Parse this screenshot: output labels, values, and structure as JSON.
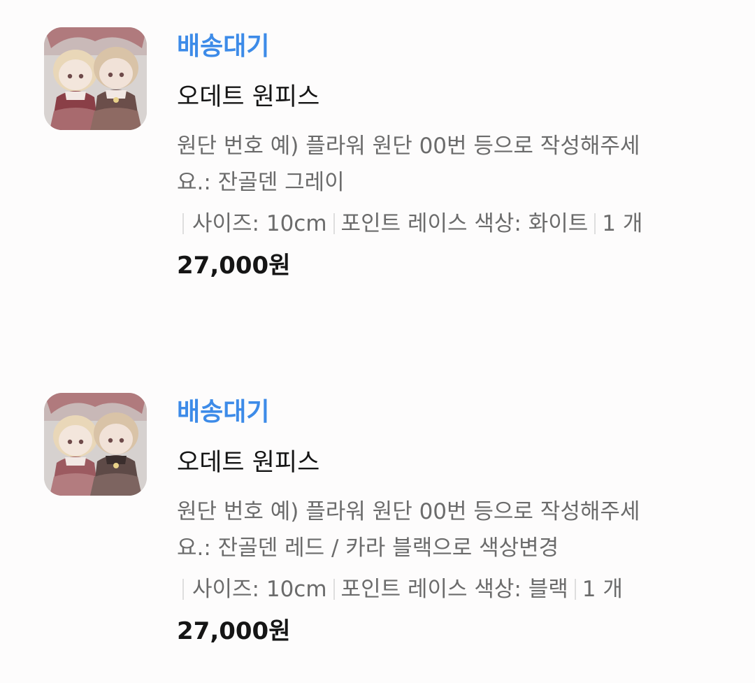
{
  "orders": [
    {
      "status": "배송대기",
      "product_name": "오데트 원피스",
      "option_line1": "원단 번호 예) 플라워 원단 00번 등으로 작성해주세",
      "option_line2": "요.: 잔골덴 그레이",
      "size": "사이즈: 10cm",
      "lace_color": "포인트 레이스 색상: 화이트",
      "quantity": "1 개",
      "price": "27,000원",
      "thumbnail_icon": "doll-photo"
    },
    {
      "status": "배송대기",
      "product_name": "오데트 원피스",
      "option_line1": "원단 번호 예) 플라워 원단 00번 등으로 작성해주세",
      "option_line2": "요.: 잔골덴 레드 / 카라 블랙으로 색상변경",
      "size": "사이즈: 10cm",
      "lace_color": "포인트 레이스 색상: 블랙",
      "quantity": "1 개",
      "price": "27,000원",
      "thumbnail_icon": "doll-photo"
    }
  ],
  "colors": {
    "status": "#3d8be8",
    "title": "#151515",
    "secondary": "#6b6b6b",
    "separator": "#dedede"
  }
}
